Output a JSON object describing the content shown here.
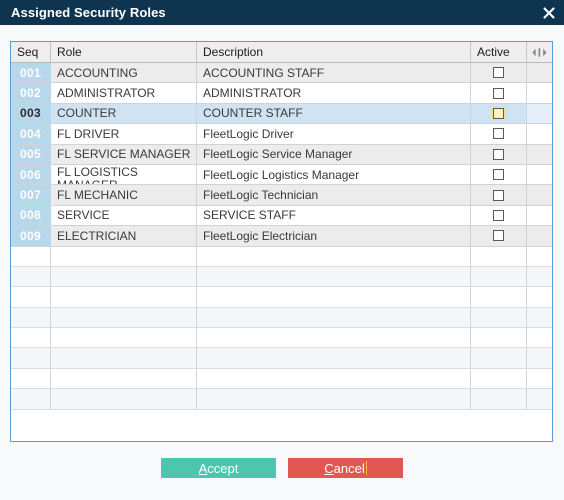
{
  "window": {
    "title": "Assigned Security Roles",
    "close_icon": "close-icon",
    "titlebar_color": "#0f3450"
  },
  "grid": {
    "border_color": "#5b9bd5",
    "columns": [
      {
        "key": "seq",
        "label": "Seq"
      },
      {
        "key": "role",
        "label": "Role"
      },
      {
        "key": "description",
        "label": "Description"
      },
      {
        "key": "active",
        "label": "Active"
      }
    ],
    "resize_grip_icon": "column-resize-grip-icon",
    "selected_seq": "003",
    "rows": [
      {
        "seq": "001",
        "role": "ACCOUNTING",
        "description": "ACCOUNTING STAFF",
        "active": false
      },
      {
        "seq": "002",
        "role": "ADMINISTRATOR",
        "description": "ADMINISTRATOR",
        "active": false
      },
      {
        "seq": "003",
        "role": "COUNTER",
        "description": "COUNTER STAFF",
        "active": false
      },
      {
        "seq": "004",
        "role": "FL DRIVER",
        "description": "FleetLogic Driver",
        "active": false
      },
      {
        "seq": "005",
        "role": "FL SERVICE MANAGER",
        "description": "FleetLogic Service Manager",
        "active": false
      },
      {
        "seq": "006",
        "role": "FL LOGISTICS MANAGER",
        "description": "FleetLogic Logistics Manager",
        "active": false
      },
      {
        "seq": "007",
        "role": "FL MECHANIC",
        "description": "FleetLogic Technician",
        "active": false
      },
      {
        "seq": "008",
        "role": "SERVICE",
        "description": "SERVICE STAFF",
        "active": false
      },
      {
        "seq": "009",
        "role": "ELECTRICIAN",
        "description": "FleetLogic Electrician",
        "active": false
      }
    ],
    "empty_row_count": 8
  },
  "footer": {
    "accept_label": "Accept",
    "accept_accelerator": "A",
    "accept_color": "#4ec5ae",
    "cancel_label": "Cancel",
    "cancel_accelerator": "C",
    "cancel_color": "#e0584f"
  }
}
